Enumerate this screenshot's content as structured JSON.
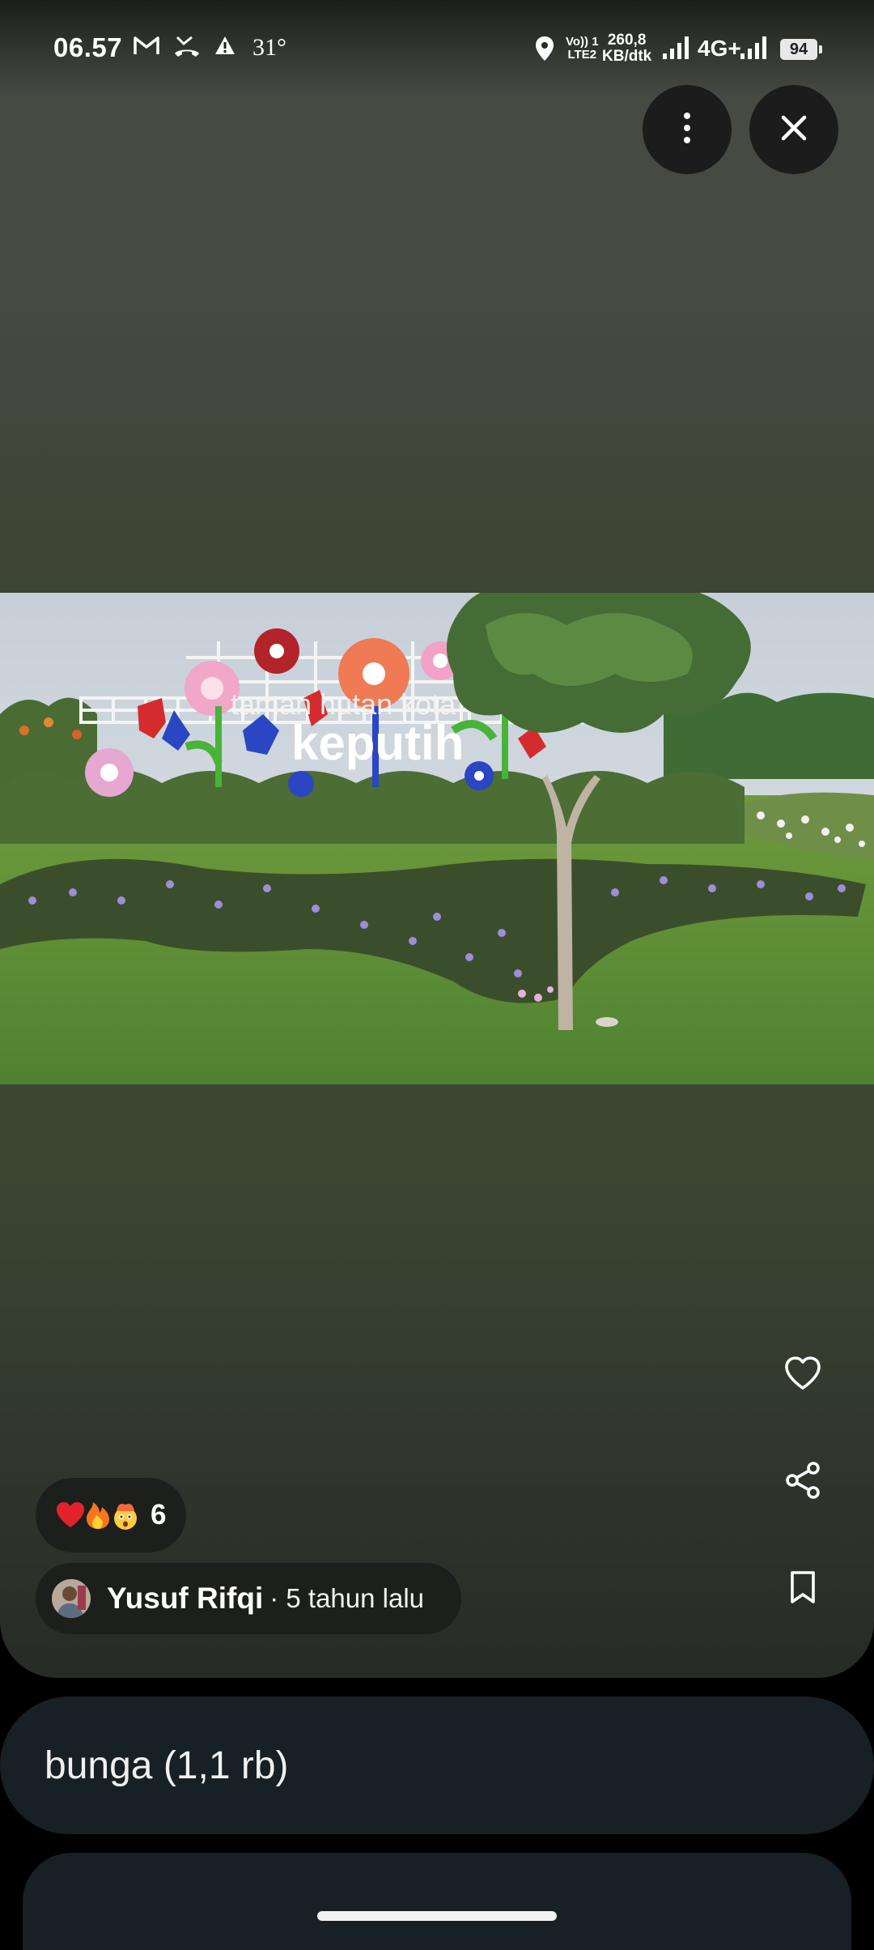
{
  "status_bar": {
    "time": "06.57",
    "temperature": "31°",
    "network_speed_value": "260,8",
    "network_speed_unit": "KB/dtk",
    "volte_top": "Vo)) 1",
    "volte_bottom": "LTE2",
    "network_type": "4G+",
    "battery": "94",
    "icons": [
      "gmail-icon",
      "missed-call-icon",
      "warning-icon",
      "location-icon",
      "signal-icon",
      "battery-icon"
    ]
  },
  "top_actions": {
    "more_icon": "more-vertical-icon",
    "close_icon": "close-icon"
  },
  "photo": {
    "description_icon": "photo",
    "sign_text_line1": "taman hutan kota",
    "sign_text_line2": "keputih"
  },
  "side_actions": [
    "heart-icon",
    "share-icon",
    "bookmark-icon"
  ],
  "reactions": {
    "emojis": [
      "red-heart",
      "fire",
      "exploding-head"
    ],
    "count": "6"
  },
  "author": {
    "name": "Yusuf Rifqi",
    "time": "· 5 tahun lalu"
  },
  "tag_card": {
    "label": "bunga (1,1 rb)"
  }
}
